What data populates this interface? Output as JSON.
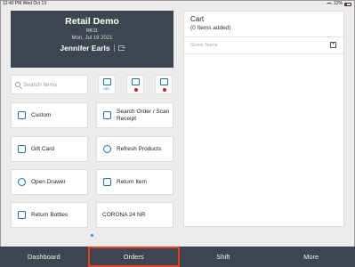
{
  "status_bar": {
    "time_date": "12:40 PM  Wed Oct 13",
    "battery": "12%"
  },
  "store_card": {
    "store_name": "Retail Demo",
    "register": "RK11",
    "date": "Mon, Jul 19 2021",
    "user_name": "Jennifer Earls"
  },
  "search": {
    "placeholder": "Search Items"
  },
  "quick_buttons": [
    {
      "icon": "barcode-scanner-icon",
      "label": "UPC"
    },
    {
      "icon": "printer-icon",
      "status_color": "#d01f1f"
    },
    {
      "icon": "card-reader-icon",
      "status_color": "#d01f1f"
    }
  ],
  "tiles": {
    "custom": "Custom",
    "search_order": "Search Order / Scan Receipt",
    "gift_card": "Gift Card",
    "refresh_products": "Refresh Products",
    "open_drawer": "Open Drawer",
    "return_item": "Return Item",
    "return_bottles": "Return Bottles",
    "corona": "CORONA  24 NR"
  },
  "cart": {
    "title": "Cart",
    "count": "(0 Items added)",
    "guest_placeholder": "Guest Name"
  },
  "tabs": [
    "Dashboard",
    "Orders",
    "Shift",
    "More"
  ],
  "colors": {
    "accent": "#1f6fb2",
    "tabbar": "#3d4550",
    "highlight": "#e04224"
  }
}
